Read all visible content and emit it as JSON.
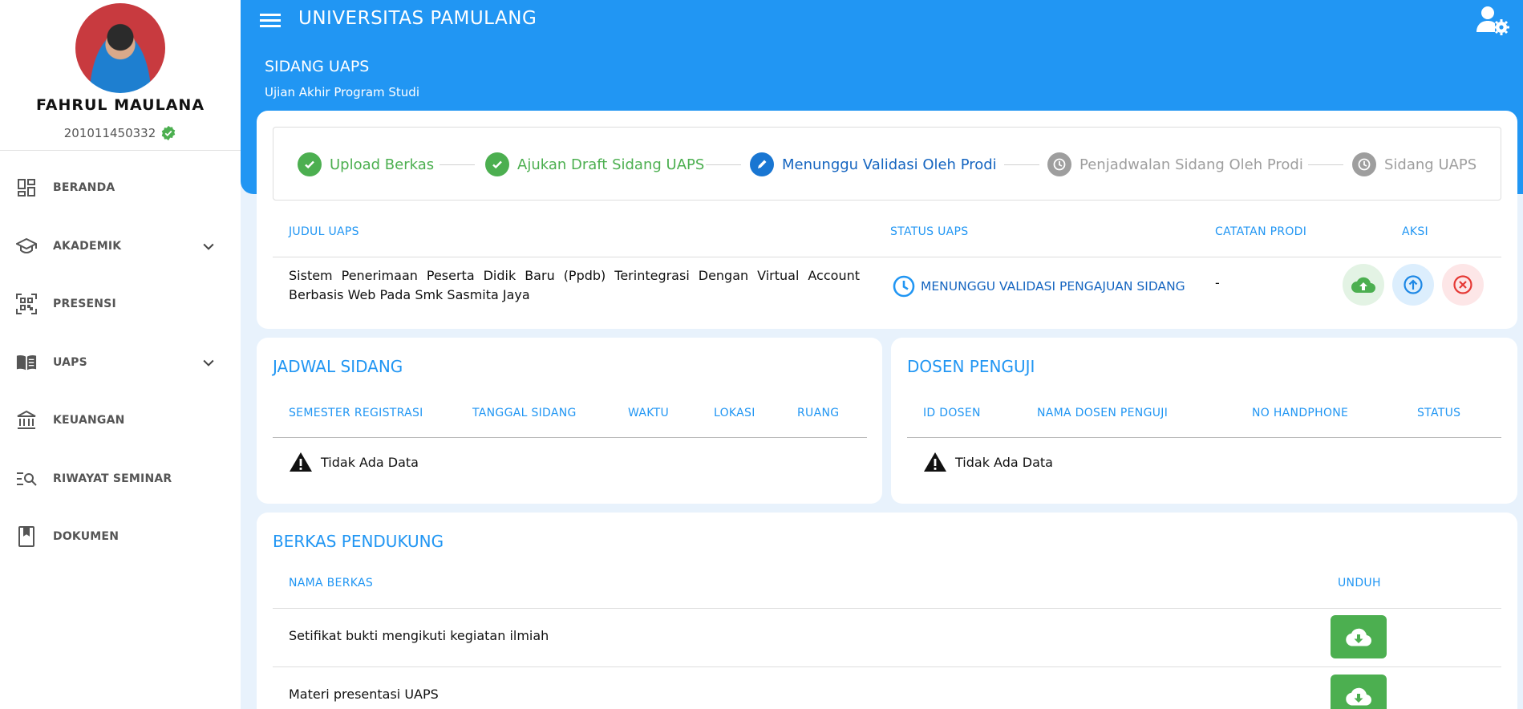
{
  "profile": {
    "name": "FAHRUL MAULANA",
    "nim": "201011450332"
  },
  "sidebar": {
    "items": [
      {
        "label": "BERANDA",
        "icon": "dashboard-icon"
      },
      {
        "label": "AKADEMIK",
        "icon": "graduation-cap-icon",
        "expandable": true
      },
      {
        "label": "PRESENSI",
        "icon": "qr-code-icon"
      },
      {
        "label": "UAPS",
        "icon": "book-open-icon",
        "expandable": true
      },
      {
        "label": "KEUANGAN",
        "icon": "bank-icon"
      },
      {
        "label": "RIWAYAT SEMINAR",
        "icon": "list-search-icon"
      },
      {
        "label": "DOKUMEN",
        "icon": "bookmark-book-icon"
      }
    ]
  },
  "header": {
    "app_title": "UNIVERSITAS PAMULANG",
    "page_title": "SIDANG UAPS",
    "page_subtitle": "Ujian Akhir Program Studi"
  },
  "stepper": {
    "steps": [
      {
        "label": "Upload Berkas",
        "state": "done"
      },
      {
        "label": "Ajukan Draft Sidang UAPS",
        "state": "done"
      },
      {
        "label": "Menunggu Validasi Oleh Prodi",
        "state": "active"
      },
      {
        "label": "Penjadwalan Sidang Oleh Prodi",
        "state": "pending"
      },
      {
        "label": "Sidang UAPS",
        "state": "pending"
      }
    ]
  },
  "uaps_table": {
    "headers": {
      "judul": "JUDUL UAPS",
      "status": "STATUS UAPS",
      "catatan": "CATATAN PRODI",
      "aksi": "AKSI"
    },
    "row": {
      "judul": "Sistem Penerimaan Peserta Didik Baru (Ppdb) Terintegrasi Dengan Virtual Account Berbasis Web Pada Smk Sasmita Jaya",
      "status": "MENUNGGU VALIDASI PENGAJUAN SIDANG",
      "catatan": "-"
    }
  },
  "jadwal": {
    "title": "JADWAL SIDANG",
    "headers": [
      "SEMESTER REGISTRASI",
      "TANGGAL SIDANG",
      "WAKTU",
      "LOKASI",
      "RUANG"
    ],
    "empty": "Tidak Ada Data"
  },
  "dosen": {
    "title": "DOSEN PENGUJI",
    "headers": [
      "ID DOSEN",
      "NAMA DOSEN PENGUJI",
      "NO HANDPHONE",
      "STATUS"
    ],
    "empty": "Tidak Ada Data"
  },
  "berkas": {
    "title": "BERKAS PENDUKUNG",
    "headers": {
      "nama": "NAMA BERKAS",
      "unduh": "UNDUH"
    },
    "rows": [
      {
        "nama": "Setifikat bukti mengikuti kegiatan ilmiah"
      },
      {
        "nama": "Materi presentasi UAPS"
      }
    ]
  },
  "colors": {
    "primary": "#2196f3",
    "success": "#4caf50",
    "danger": "#e53935",
    "muted": "#9e9e9e"
  }
}
